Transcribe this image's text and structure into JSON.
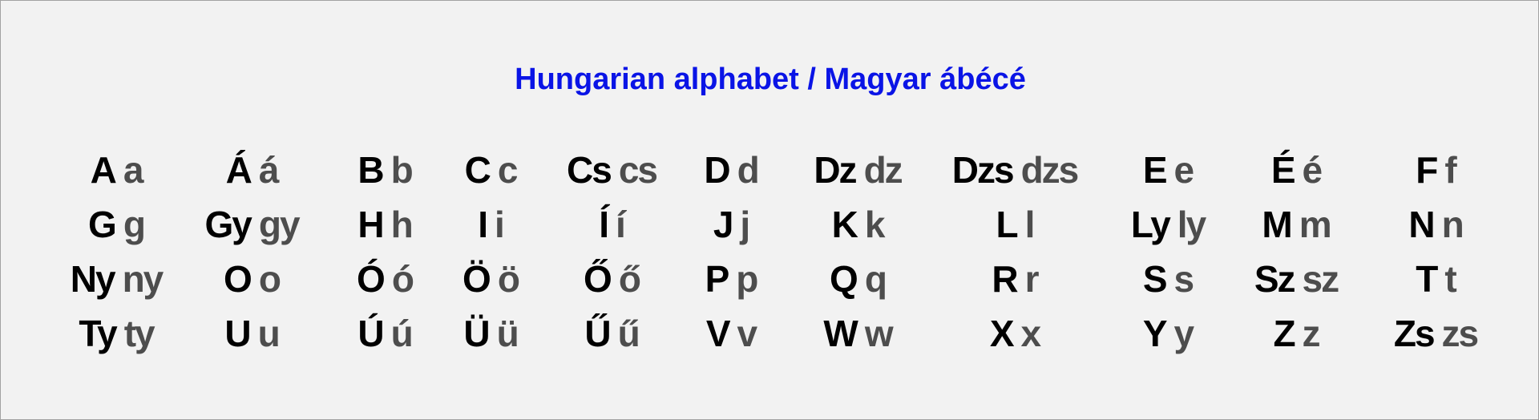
{
  "title": "Hungarian alphabet / Magyar ábécé",
  "colors": {
    "title": "#0a14e6",
    "uppercase": "#000000",
    "lowercase": "#4d4d4d",
    "background": "#f2f2f2"
  },
  "rows": [
    [
      {
        "upper": "A",
        "lower": "a"
      },
      {
        "upper": "Á",
        "lower": "á"
      },
      {
        "upper": "B",
        "lower": "b"
      },
      {
        "upper": "C",
        "lower": "c"
      },
      {
        "upper": "Cs",
        "lower": "cs"
      },
      {
        "upper": "D",
        "lower": "d"
      },
      {
        "upper": "Dz",
        "lower": "dz"
      },
      {
        "upper": "Dzs",
        "lower": "dzs"
      },
      {
        "upper": "E",
        "lower": "e"
      },
      {
        "upper": "É",
        "lower": "é"
      },
      {
        "upper": "F",
        "lower": "f"
      }
    ],
    [
      {
        "upper": "G",
        "lower": "g"
      },
      {
        "upper": "Gy",
        "lower": "gy"
      },
      {
        "upper": "H",
        "lower": "h"
      },
      {
        "upper": "I",
        "lower": "i"
      },
      {
        "upper": "Í",
        "lower": "í"
      },
      {
        "upper": "J",
        "lower": "j"
      },
      {
        "upper": "K",
        "lower": "k"
      },
      {
        "upper": "L",
        "lower": "l"
      },
      {
        "upper": "Ly",
        "lower": "ly"
      },
      {
        "upper": "M",
        "lower": "m"
      },
      {
        "upper": "N",
        "lower": "n"
      }
    ],
    [
      {
        "upper": "Ny",
        "lower": "ny"
      },
      {
        "upper": "O",
        "lower": "o"
      },
      {
        "upper": "Ó",
        "lower": "ó"
      },
      {
        "upper": "Ö",
        "lower": "ö"
      },
      {
        "upper": "Ő",
        "lower": "ő"
      },
      {
        "upper": "P",
        "lower": "p"
      },
      {
        "upper": "Q",
        "lower": "q"
      },
      {
        "upper": "R",
        "lower": "r"
      },
      {
        "upper": "S",
        "lower": "s"
      },
      {
        "upper": "Sz",
        "lower": "sz"
      },
      {
        "upper": "T",
        "lower": "t"
      }
    ],
    [
      {
        "upper": "Ty",
        "lower": "ty"
      },
      {
        "upper": "U",
        "lower": "u"
      },
      {
        "upper": "Ú",
        "lower": "ú"
      },
      {
        "upper": "Ü",
        "lower": "ü"
      },
      {
        "upper": "Ű",
        "lower": "ű"
      },
      {
        "upper": "V",
        "lower": "v"
      },
      {
        "upper": "W",
        "lower": "w"
      },
      {
        "upper": "X",
        "lower": "x"
      },
      {
        "upper": "Y",
        "lower": "y"
      },
      {
        "upper": "Z",
        "lower": "z"
      },
      {
        "upper": "Zs",
        "lower": "zs"
      }
    ]
  ]
}
